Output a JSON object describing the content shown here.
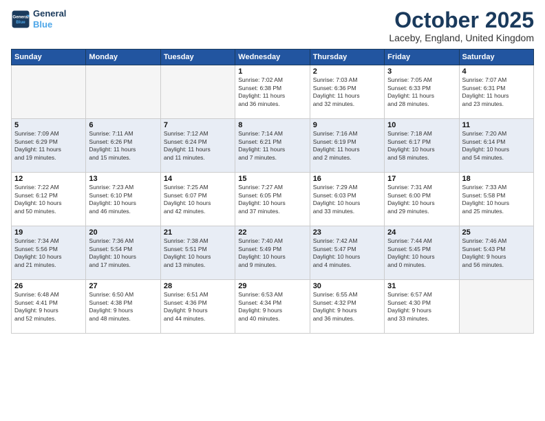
{
  "logo": {
    "line1": "General",
    "line2": "Blue"
  },
  "title": "October 2025",
  "location": "Laceby, England, United Kingdom",
  "days_of_week": [
    "Sunday",
    "Monday",
    "Tuesday",
    "Wednesday",
    "Thursday",
    "Friday",
    "Saturday"
  ],
  "weeks": [
    [
      {
        "day": "",
        "info": ""
      },
      {
        "day": "",
        "info": ""
      },
      {
        "day": "",
        "info": ""
      },
      {
        "day": "1",
        "info": "Sunrise: 7:02 AM\nSunset: 6:38 PM\nDaylight: 11 hours\nand 36 minutes."
      },
      {
        "day": "2",
        "info": "Sunrise: 7:03 AM\nSunset: 6:36 PM\nDaylight: 11 hours\nand 32 minutes."
      },
      {
        "day": "3",
        "info": "Sunrise: 7:05 AM\nSunset: 6:33 PM\nDaylight: 11 hours\nand 28 minutes."
      },
      {
        "day": "4",
        "info": "Sunrise: 7:07 AM\nSunset: 6:31 PM\nDaylight: 11 hours\nand 23 minutes."
      }
    ],
    [
      {
        "day": "5",
        "info": "Sunrise: 7:09 AM\nSunset: 6:29 PM\nDaylight: 11 hours\nand 19 minutes."
      },
      {
        "day": "6",
        "info": "Sunrise: 7:11 AM\nSunset: 6:26 PM\nDaylight: 11 hours\nand 15 minutes."
      },
      {
        "day": "7",
        "info": "Sunrise: 7:12 AM\nSunset: 6:24 PM\nDaylight: 11 hours\nand 11 minutes."
      },
      {
        "day": "8",
        "info": "Sunrise: 7:14 AM\nSunset: 6:21 PM\nDaylight: 11 hours\nand 7 minutes."
      },
      {
        "day": "9",
        "info": "Sunrise: 7:16 AM\nSunset: 6:19 PM\nDaylight: 11 hours\nand 2 minutes."
      },
      {
        "day": "10",
        "info": "Sunrise: 7:18 AM\nSunset: 6:17 PM\nDaylight: 10 hours\nand 58 minutes."
      },
      {
        "day": "11",
        "info": "Sunrise: 7:20 AM\nSunset: 6:14 PM\nDaylight: 10 hours\nand 54 minutes."
      }
    ],
    [
      {
        "day": "12",
        "info": "Sunrise: 7:22 AM\nSunset: 6:12 PM\nDaylight: 10 hours\nand 50 minutes."
      },
      {
        "day": "13",
        "info": "Sunrise: 7:23 AM\nSunset: 6:10 PM\nDaylight: 10 hours\nand 46 minutes."
      },
      {
        "day": "14",
        "info": "Sunrise: 7:25 AM\nSunset: 6:07 PM\nDaylight: 10 hours\nand 42 minutes."
      },
      {
        "day": "15",
        "info": "Sunrise: 7:27 AM\nSunset: 6:05 PM\nDaylight: 10 hours\nand 37 minutes."
      },
      {
        "day": "16",
        "info": "Sunrise: 7:29 AM\nSunset: 6:03 PM\nDaylight: 10 hours\nand 33 minutes."
      },
      {
        "day": "17",
        "info": "Sunrise: 7:31 AM\nSunset: 6:00 PM\nDaylight: 10 hours\nand 29 minutes."
      },
      {
        "day": "18",
        "info": "Sunrise: 7:33 AM\nSunset: 5:58 PM\nDaylight: 10 hours\nand 25 minutes."
      }
    ],
    [
      {
        "day": "19",
        "info": "Sunrise: 7:34 AM\nSunset: 5:56 PM\nDaylight: 10 hours\nand 21 minutes."
      },
      {
        "day": "20",
        "info": "Sunrise: 7:36 AM\nSunset: 5:54 PM\nDaylight: 10 hours\nand 17 minutes."
      },
      {
        "day": "21",
        "info": "Sunrise: 7:38 AM\nSunset: 5:51 PM\nDaylight: 10 hours\nand 13 minutes."
      },
      {
        "day": "22",
        "info": "Sunrise: 7:40 AM\nSunset: 5:49 PM\nDaylight: 10 hours\nand 9 minutes."
      },
      {
        "day": "23",
        "info": "Sunrise: 7:42 AM\nSunset: 5:47 PM\nDaylight: 10 hours\nand 4 minutes."
      },
      {
        "day": "24",
        "info": "Sunrise: 7:44 AM\nSunset: 5:45 PM\nDaylight: 10 hours\nand 0 minutes."
      },
      {
        "day": "25",
        "info": "Sunrise: 7:46 AM\nSunset: 5:43 PM\nDaylight: 9 hours\nand 56 minutes."
      }
    ],
    [
      {
        "day": "26",
        "info": "Sunrise: 6:48 AM\nSunset: 4:41 PM\nDaylight: 9 hours\nand 52 minutes."
      },
      {
        "day": "27",
        "info": "Sunrise: 6:50 AM\nSunset: 4:38 PM\nDaylight: 9 hours\nand 48 minutes."
      },
      {
        "day": "28",
        "info": "Sunrise: 6:51 AM\nSunset: 4:36 PM\nDaylight: 9 hours\nand 44 minutes."
      },
      {
        "day": "29",
        "info": "Sunrise: 6:53 AM\nSunset: 4:34 PM\nDaylight: 9 hours\nand 40 minutes."
      },
      {
        "day": "30",
        "info": "Sunrise: 6:55 AM\nSunset: 4:32 PM\nDaylight: 9 hours\nand 36 minutes."
      },
      {
        "day": "31",
        "info": "Sunrise: 6:57 AM\nSunset: 4:30 PM\nDaylight: 9 hours\nand 33 minutes."
      },
      {
        "day": "",
        "info": ""
      }
    ]
  ]
}
